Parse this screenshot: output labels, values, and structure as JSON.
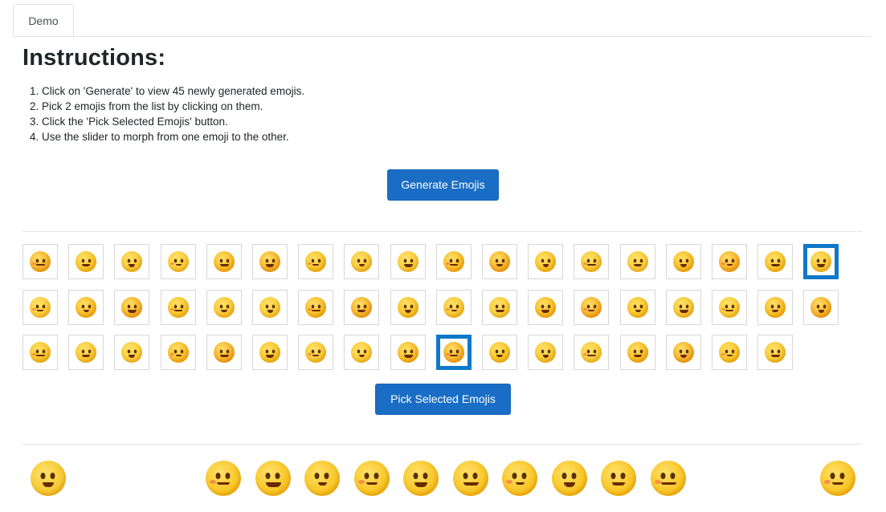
{
  "tabs": [
    {
      "label": "Demo"
    }
  ],
  "heading": "Instructions:",
  "instructions": [
    "Click on 'Generate' to view 45 newly generated emojis.",
    "Pick 2 emojis from the list by clicking on them.",
    "Click the 'Pick Selected Emojis' button.",
    "Use the slider to morph from one emoji to the other."
  ],
  "generate_button": "Generate Emojis",
  "pick_button": "Pick Selected Emojis",
  "emoji_grid": {
    "count": 53,
    "per_row": 18,
    "selected": [
      17,
      45
    ],
    "emojis": [
      "neutral-face",
      "squinting-laugh-face",
      "exploding-head",
      "winking-face",
      "hot-face",
      "smiling-face",
      "sad-face",
      "bandaged-face",
      "woozy-face",
      "screaming-face",
      "cloud-face",
      "sick-face",
      "money-face",
      "party-face",
      "crying-face",
      "kissing-face",
      "cold-face",
      "rolling-laugh-face",
      "surprised-face",
      "thinking-face",
      "anxious-face",
      "tongue-face",
      "astonished-face",
      "grinning-face",
      "frowning-face",
      "starstruck-face",
      "hushed-face",
      "yawning-face",
      "angry-face",
      "kissing-closed-eyes-face",
      "dizzy-face",
      "relieved-face",
      "upside-down-face",
      "smirking-face",
      "unamused-face",
      "flushed-face",
      "grimacing-face",
      "pleading-face",
      "spiral-eyes-face",
      "hand-over-mouth-face",
      "fearful-face",
      "blushing-face",
      "nerd-face",
      "yum-face",
      "disguised-face",
      "worried-face",
      "pouting-face",
      "cowboy-face",
      "sleepy-face",
      "confused-face",
      "smiling-eyes-face",
      "shocked-face",
      "zany-face"
    ]
  },
  "morph_strip": {
    "start": "rolling-laugh-face",
    "steps": [
      "morph-step-1",
      "morph-step-2",
      "morph-step-3",
      "morph-step-4",
      "morph-step-5",
      "morph-step-6",
      "morph-step-7",
      "morph-step-8",
      "morph-step-9",
      "morph-step-10"
    ],
    "end": "worried-face"
  },
  "colors": {
    "primary": "#1a6dc4",
    "selection": "#0f78c8",
    "face": "#f6c21a"
  }
}
